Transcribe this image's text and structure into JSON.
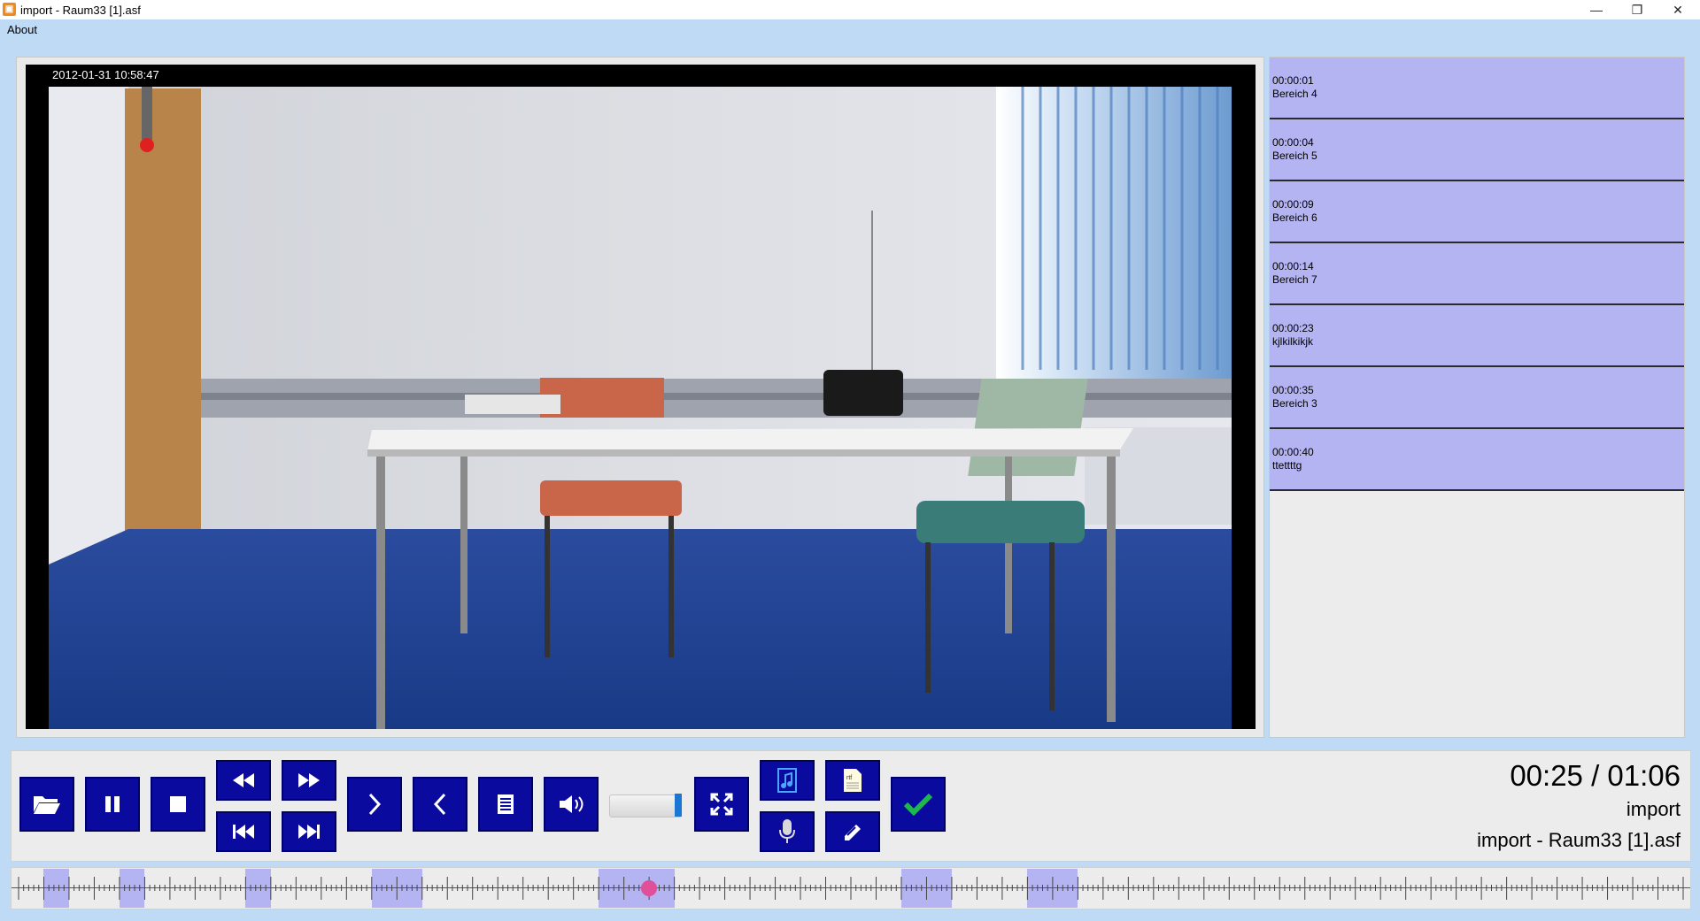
{
  "window": {
    "title": "import - Raum33 [1].asf",
    "icon": "app-icon",
    "minimize": "—",
    "restore": "❐",
    "close": "✕"
  },
  "menu": {
    "about": "About"
  },
  "video": {
    "timestamp": "2012-01-31 10:58:47"
  },
  "markers": [
    {
      "time": "00:00:01",
      "label": "Bereich 4"
    },
    {
      "time": "00:00:04",
      "label": "Bereich 5"
    },
    {
      "time": "00:00:09",
      "label": "Bereich 6"
    },
    {
      "time": "00:00:14",
      "label": "Bereich 7"
    },
    {
      "time": "00:00:23",
      "label": "kjlkilkikjk"
    },
    {
      "time": "00:00:35",
      "label": "Bereich 3"
    },
    {
      "time": "00:00:40",
      "label": "ttettttg"
    }
  ],
  "controls": {
    "buttons": [
      "folder-open-icon",
      "pause-icon",
      "stop-icon",
      "rewind-icon",
      "fast-forward-icon",
      "skip-back-icon",
      "skip-forward-icon",
      "next-icon",
      "previous-icon",
      "list-icon",
      "volume-icon",
      "fullscreen-icon",
      "music-note-icon",
      "rtf-document-icon",
      "microphone-icon",
      "edit-icon",
      "checkmark-icon"
    ],
    "volume_level": 0.92,
    "time_display": "00:25 / 01:06",
    "project_name": "import",
    "file_name": "import - Raum33 [1].asf"
  },
  "timeline": {
    "duration_s": 66,
    "position_s": 25,
    "marker_segments_s": [
      [
        1,
        2
      ],
      [
        4,
        5
      ],
      [
        9,
        10
      ],
      [
        14,
        16
      ],
      [
        23,
        26
      ],
      [
        35,
        37
      ],
      [
        40,
        42
      ]
    ]
  },
  "colors": {
    "menubar": "#bfdaf5",
    "button": "#0a0a9e",
    "marker": "#b4b4f2",
    "playhead": "#e0509a",
    "accent_check": "#1db84a"
  }
}
